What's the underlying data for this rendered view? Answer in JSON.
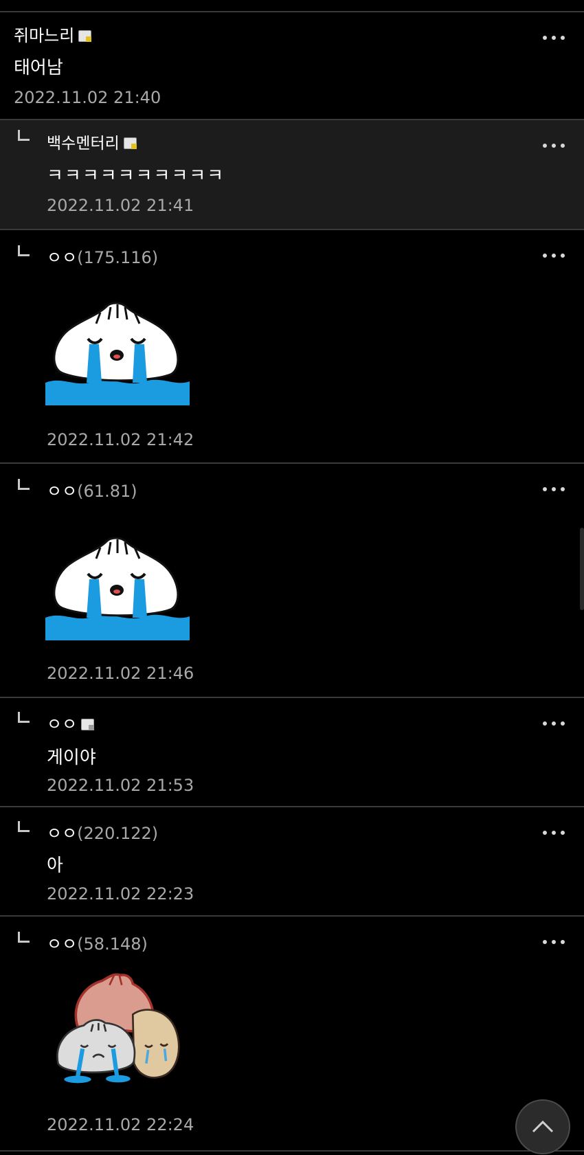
{
  "comments": [
    {
      "nick": "쥐마느리",
      "ip": "",
      "text": "태어남",
      "time": "2022.11.02 21:40"
    },
    {
      "nick": "백수멘터리",
      "ip": "",
      "text": "ㅋㅋㅋㅋㅋㅋㅋㅋㅋㅋ",
      "time": "2022.11.02 21:41"
    },
    {
      "nick": "ㅇㅇ",
      "ip": "(175.116)",
      "sticker": "crying-dumpling",
      "time": "2022.11.02 21:42"
    },
    {
      "nick": "ㅇㅇ",
      "ip": "(61.81)",
      "sticker": "crying-dumpling",
      "time": "2022.11.02 21:46"
    },
    {
      "nick": "ㅇㅇ",
      "ip": "",
      "text": "게이야",
      "time": "2022.11.02 21:53"
    },
    {
      "nick": "ㅇㅇ",
      "ip": "(220.122)",
      "text": "아",
      "time": "2022.11.02 22:23"
    },
    {
      "nick": "ㅇㅇ",
      "ip": "(58.148)",
      "sticker": "crying-dumpling-with-friends",
      "time": "2022.11.02 22:24"
    }
  ],
  "icons": {
    "more": "more-dots-icon",
    "reply": "reply-arrow-icon",
    "badge": "member-badge-icon",
    "top": "chevron-up-icon"
  },
  "colors": {
    "background": "#000000",
    "highlight_row": "#1c1c1c",
    "timestamp": "#a9a9a9",
    "sticker_water": "#1b9be0",
    "gallery_badge": "#e2c21d"
  }
}
